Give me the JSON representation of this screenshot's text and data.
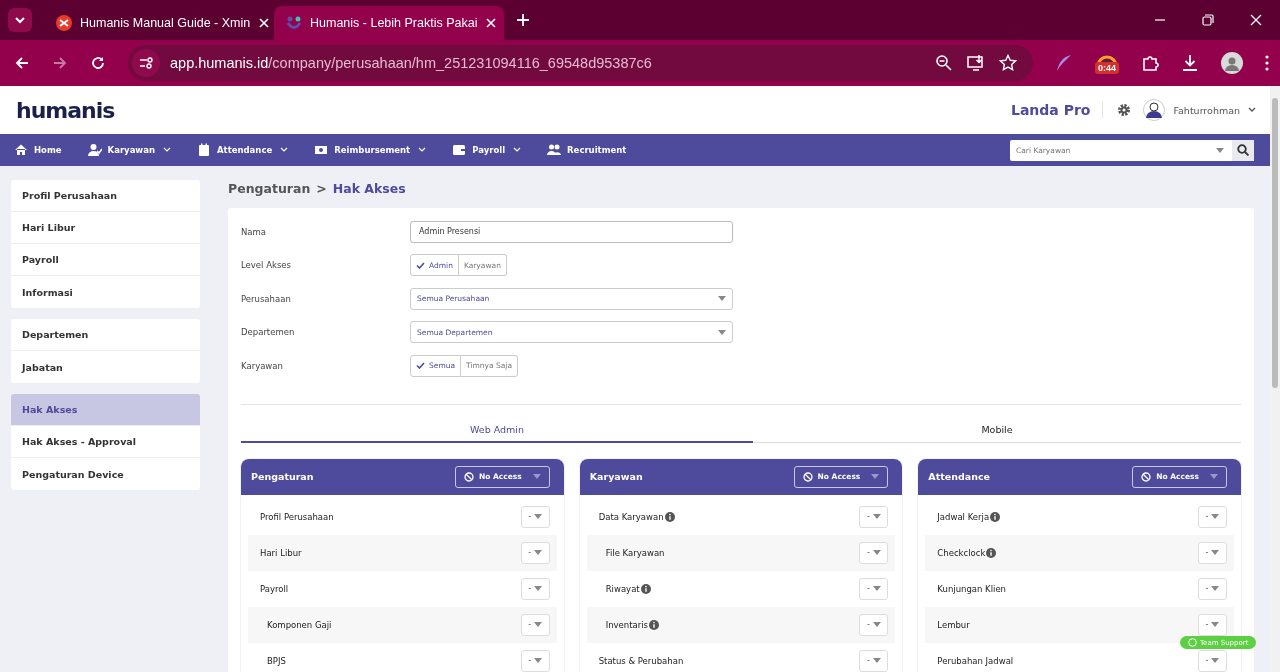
{
  "browser": {
    "tabs": [
      {
        "title": "Humanis Manual Guide - Xmin",
        "selected": false
      },
      {
        "title": "Humanis - Lebih Praktis Pakai",
        "selected": true
      }
    ],
    "url_host": "app.humanis.id",
    "url_path": "/company/perusahaan/hm_251231094116_69548d95387c6",
    "extension_badge": "0:44"
  },
  "header": {
    "logo": "humanis",
    "company": "Landa Pro",
    "user": "Fahturrohman"
  },
  "nav": {
    "items": [
      {
        "label": "Home",
        "kind": "home",
        "dropdown": false
      },
      {
        "label": "Karyawan",
        "kind": "user",
        "dropdown": true
      },
      {
        "label": "Attendance",
        "kind": "calendar",
        "dropdown": true
      },
      {
        "label": "Reimbursement",
        "kind": "money",
        "dropdown": true
      },
      {
        "label": "Payroll",
        "kind": "wallet",
        "dropdown": true
      },
      {
        "label": "Recruitment",
        "kind": "users",
        "dropdown": false
      }
    ],
    "search_placeholder": "Cari Karyawan"
  },
  "sidebar": {
    "groups": [
      {
        "items": [
          {
            "label": "Profil Perusahaan",
            "selected": false
          },
          {
            "label": "Hari Libur",
            "selected": false
          },
          {
            "label": "Payroll",
            "selected": false
          },
          {
            "label": "Informasi",
            "selected": false
          }
        ]
      },
      {
        "items": [
          {
            "label": "Departemen",
            "selected": false
          },
          {
            "label": "Jabatan",
            "selected": false
          }
        ]
      },
      {
        "items": [
          {
            "label": "Hak Akses",
            "selected": true
          },
          {
            "label": "Hak Akses - Approval",
            "selected": false
          },
          {
            "label": "Pengaturan Device",
            "selected": false
          }
        ]
      }
    ]
  },
  "breadcrumb": {
    "parent": "Pengaturan",
    "separator": ">",
    "current": "Hak Akses"
  },
  "form": {
    "fields": [
      {
        "label": "Nama",
        "kind": "text",
        "value": "Admin Presensi"
      },
      {
        "label": "Level Akses",
        "kind": "toggle",
        "options": [
          {
            "label": "Admin",
            "selected": true
          },
          {
            "label": "Karyawan",
            "selected": false
          }
        ]
      },
      {
        "label": "Perusahaan",
        "kind": "select",
        "value": "Semua Perusahaan"
      },
      {
        "label": "Departemen",
        "kind": "select",
        "value": "Semua Departemen"
      },
      {
        "label": "Karyawan",
        "kind": "toggle",
        "options": [
          {
            "label": "Semua",
            "selected": true
          },
          {
            "label": "Timnya Saja",
            "selected": false
          }
        ]
      }
    ]
  },
  "tabs": [
    {
      "label": "Web Admin",
      "selected": true
    },
    {
      "label": "Mobile",
      "selected": false
    }
  ],
  "panels": [
    {
      "title": "Pengaturan",
      "access": "No Access",
      "rows": [
        {
          "label": "Profil Perusahaan",
          "indent": false,
          "info": false,
          "value": "-"
        },
        {
          "label": "Hari Libur",
          "indent": false,
          "info": false,
          "value": "-"
        },
        {
          "label": "Payroll",
          "indent": false,
          "info": false,
          "value": "-"
        },
        {
          "label": "Komponen Gaji",
          "indent": true,
          "info": false,
          "value": "-"
        },
        {
          "label": "BPJS",
          "indent": true,
          "info": false,
          "value": "-"
        }
      ]
    },
    {
      "title": "Karyawan",
      "access": "No Access",
      "rows": [
        {
          "label": "Data Karyawan",
          "indent": false,
          "info": true,
          "value": "-"
        },
        {
          "label": "File Karyawan",
          "indent": true,
          "info": false,
          "value": "-"
        },
        {
          "label": "Riwayat",
          "indent": true,
          "info": true,
          "value": "-"
        },
        {
          "label": "Inventaris",
          "indent": true,
          "info": true,
          "value": "-"
        },
        {
          "label": "Status & Perubahan",
          "indent": false,
          "info": false,
          "value": "-"
        }
      ]
    },
    {
      "title": "Attendance",
      "access": "No Access",
      "rows": [
        {
          "label": "Jadwal Kerja",
          "indent": false,
          "info": true,
          "value": "-"
        },
        {
          "label": "Checkclock",
          "indent": false,
          "info": true,
          "value": "-"
        },
        {
          "label": "Kunjungan Klien",
          "indent": false,
          "info": false,
          "value": "-"
        },
        {
          "label": "Lembur",
          "indent": false,
          "info": false,
          "value": "-"
        },
        {
          "label": "Perubahan Jadwal",
          "indent": false,
          "info": false,
          "value": "-"
        }
      ]
    }
  ],
  "support_button": "Team Support"
}
